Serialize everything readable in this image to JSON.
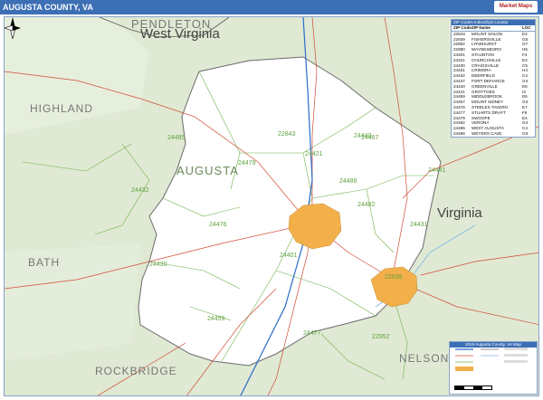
{
  "title": "AUGUSTA COUNTY, VA",
  "brand_label": "Market Maps",
  "map": {
    "region_labels": [
      {
        "text": "PENDLETON",
        "kind": "county"
      },
      {
        "text": "West Virginia",
        "kind": "state"
      },
      {
        "text": "HIGHLAND",
        "kind": "county"
      },
      {
        "text": "AUGUSTA",
        "kind": "county"
      },
      {
        "text": "Virginia",
        "kind": "state"
      },
      {
        "text": "BATH",
        "kind": "county"
      },
      {
        "text": "ROCKBRIDGE",
        "kind": "county"
      },
      {
        "text": "NELSON",
        "kind": "county"
      }
    ],
    "zip_labels": [
      "22843",
      "24485",
      "24432",
      "24476",
      "24430",
      "24459",
      "24479",
      "24421",
      "24440",
      "24441",
      "24486",
      "24482",
      "24431",
      "24467",
      "24401",
      "24477",
      "22952",
      "22939"
    ],
    "colors": {
      "land": "#dfe9d3",
      "county_fill": "#ffffff",
      "urban": "#f3b04a",
      "road": "#d24b35",
      "zip_boundary": "#6fb24a",
      "county_border": "#6a6a6a",
      "water": "#7fb5e6"
    }
  },
  "zip_locator": {
    "header": "ZIP Codes Index/Zips Locator",
    "columns": [
      "ZIP Code",
      "ZIP Name",
      "LOC"
    ],
    "rows": [
      [
        "22843",
        "MOUNT SOLON",
        "E2"
      ],
      [
        "22939",
        "FISHERSVILLE",
        "G5"
      ],
      [
        "22952",
        "LYNDHURST",
        "G7"
      ],
      [
        "22980",
        "WAYNESBORO",
        "H5"
      ],
      [
        "24401",
        "STAUNTON",
        "F4"
      ],
      [
        "24421",
        "CHURCHVILLE",
        "E3"
      ],
      [
        "24430",
        "CRAIGSVILLE",
        "C5"
      ],
      [
        "24431",
        "CRIMORA",
        "H4"
      ],
      [
        "24432",
        "DEERFIELD",
        "C4"
      ],
      [
        "24437",
        "FORT DEFIANCE",
        "G4"
      ],
      [
        "24440",
        "GREENVILLE",
        "E6"
      ],
      [
        "24441",
        "GROTTOES",
        "I3"
      ],
      [
        "24459",
        "MIDDLEBROOK",
        "E6"
      ],
      [
        "24467",
        "MOUNT SIDNEY",
        "G3"
      ],
      [
        "24476",
        "STEELES TAVERN",
        "E7"
      ],
      [
        "24477",
        "STUARTS DRAFT",
        "F6"
      ],
      [
        "24479",
        "SWOOPE",
        "E4"
      ],
      [
        "24482",
        "VERONA",
        "G4"
      ],
      [
        "24485",
        "WEST AUGUSTA",
        "C4"
      ],
      [
        "24486",
        "WEYERS CAVE",
        "G3"
      ]
    ]
  },
  "map_legend": {
    "header": "2016 Augusta County, VA Map"
  }
}
